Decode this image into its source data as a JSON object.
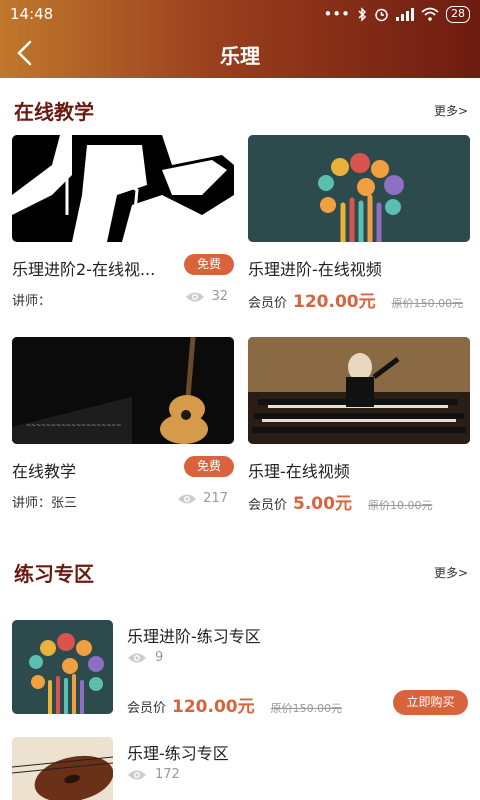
{
  "status_bar": {
    "time": "14:48",
    "battery": "28"
  },
  "header": {
    "title": "乐理"
  },
  "online": {
    "title": "在线教学",
    "more": "更多>",
    "cards": [
      {
        "title": "乐理进阶2-在线视...",
        "badge": "免费",
        "teacher": "讲师：",
        "views": "32"
      },
      {
        "title": "乐理进阶-在线视频",
        "price_label": "会员价",
        "price": "120.00元",
        "orig": "原价150.00元"
      },
      {
        "title": "在线教学",
        "badge": "免费",
        "teacher": "讲师：张三",
        "views": "217"
      },
      {
        "title": "乐理-在线视频",
        "price_label": "会员价",
        "price": "5.00元",
        "orig": "原价10.00元"
      }
    ]
  },
  "practice": {
    "title": "练习专区",
    "more": "更多>",
    "items": [
      {
        "title": "乐理进阶-练习专区",
        "views": "9",
        "price_label": "会员价",
        "price": "120.00元",
        "orig": "原价150.00元",
        "button": "立即购买"
      },
      {
        "title": "乐理-练习专区",
        "views": "172"
      }
    ]
  },
  "colors": {
    "accent": "#d8633c",
    "section_title": "#6b1a10",
    "header_start": "#c0782c",
    "header_end": "#6e1b10"
  }
}
